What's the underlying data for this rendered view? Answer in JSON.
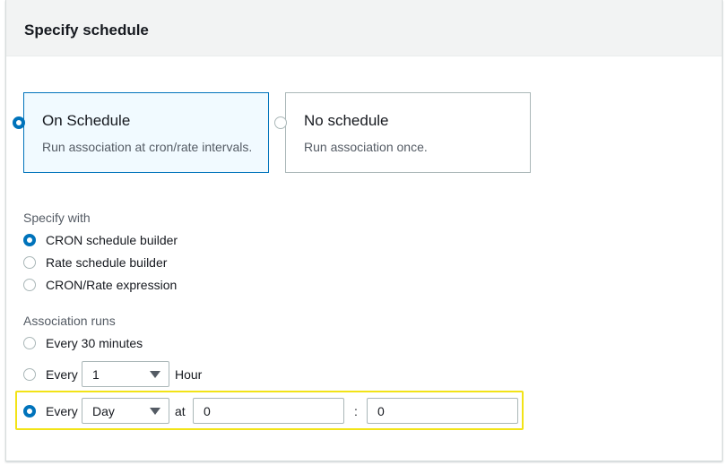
{
  "panel": {
    "title": "Specify schedule"
  },
  "schedule_options": [
    {
      "title": "On Schedule",
      "description": "Run association at cron/rate intervals.",
      "selected": true
    },
    {
      "title": "No schedule",
      "description": "Run association once.",
      "selected": false
    }
  ],
  "specify_with": {
    "label": "Specify with",
    "options": [
      {
        "label": "CRON schedule builder",
        "selected": true
      },
      {
        "label": "Rate schedule builder",
        "selected": false
      },
      {
        "label": "CRON/Rate expression",
        "selected": false
      }
    ]
  },
  "association_runs": {
    "label": "Association runs",
    "every_30": {
      "label": "Every 30 minutes",
      "selected": false
    },
    "every_hour": {
      "label_prefix": "Every",
      "select_value": "1",
      "unit": "Hour",
      "selected": false
    },
    "every_day": {
      "label_prefix": "Every",
      "select_value": "Day",
      "at_label": "at",
      "hour_value": "0",
      "separator": ":",
      "minute_value": "0",
      "selected": true
    }
  },
  "colors": {
    "accent": "#0073bb",
    "highlight": "#f2e317",
    "border": "#aab7b8",
    "header_bg": "#f2f3f3",
    "selected_tile_bg": "#f1faff"
  }
}
